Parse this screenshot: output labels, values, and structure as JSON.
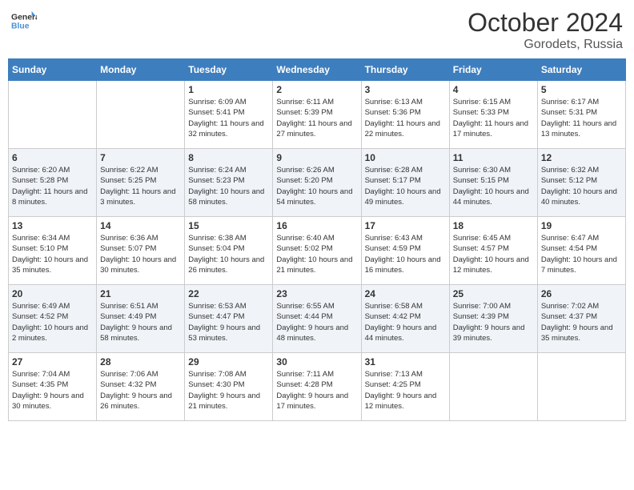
{
  "header": {
    "logo_line1": "General",
    "logo_line2": "Blue",
    "month": "October 2024",
    "location": "Gorodets, Russia"
  },
  "days_of_week": [
    "Sunday",
    "Monday",
    "Tuesday",
    "Wednesday",
    "Thursday",
    "Friday",
    "Saturday"
  ],
  "weeks": [
    [
      {
        "day": "",
        "sunrise": "",
        "sunset": "",
        "daylight": ""
      },
      {
        "day": "",
        "sunrise": "",
        "sunset": "",
        "daylight": ""
      },
      {
        "day": "1",
        "sunrise": "Sunrise: 6:09 AM",
        "sunset": "Sunset: 5:41 PM",
        "daylight": "Daylight: 11 hours and 32 minutes."
      },
      {
        "day": "2",
        "sunrise": "Sunrise: 6:11 AM",
        "sunset": "Sunset: 5:39 PM",
        "daylight": "Daylight: 11 hours and 27 minutes."
      },
      {
        "day": "3",
        "sunrise": "Sunrise: 6:13 AM",
        "sunset": "Sunset: 5:36 PM",
        "daylight": "Daylight: 11 hours and 22 minutes."
      },
      {
        "day": "4",
        "sunrise": "Sunrise: 6:15 AM",
        "sunset": "Sunset: 5:33 PM",
        "daylight": "Daylight: 11 hours and 17 minutes."
      },
      {
        "day": "5",
        "sunrise": "Sunrise: 6:17 AM",
        "sunset": "Sunset: 5:31 PM",
        "daylight": "Daylight: 11 hours and 13 minutes."
      }
    ],
    [
      {
        "day": "6",
        "sunrise": "Sunrise: 6:20 AM",
        "sunset": "Sunset: 5:28 PM",
        "daylight": "Daylight: 11 hours and 8 minutes."
      },
      {
        "day": "7",
        "sunrise": "Sunrise: 6:22 AM",
        "sunset": "Sunset: 5:25 PM",
        "daylight": "Daylight: 11 hours and 3 minutes."
      },
      {
        "day": "8",
        "sunrise": "Sunrise: 6:24 AM",
        "sunset": "Sunset: 5:23 PM",
        "daylight": "Daylight: 10 hours and 58 minutes."
      },
      {
        "day": "9",
        "sunrise": "Sunrise: 6:26 AM",
        "sunset": "Sunset: 5:20 PM",
        "daylight": "Daylight: 10 hours and 54 minutes."
      },
      {
        "day": "10",
        "sunrise": "Sunrise: 6:28 AM",
        "sunset": "Sunset: 5:17 PM",
        "daylight": "Daylight: 10 hours and 49 minutes."
      },
      {
        "day": "11",
        "sunrise": "Sunrise: 6:30 AM",
        "sunset": "Sunset: 5:15 PM",
        "daylight": "Daylight: 10 hours and 44 minutes."
      },
      {
        "day": "12",
        "sunrise": "Sunrise: 6:32 AM",
        "sunset": "Sunset: 5:12 PM",
        "daylight": "Daylight: 10 hours and 40 minutes."
      }
    ],
    [
      {
        "day": "13",
        "sunrise": "Sunrise: 6:34 AM",
        "sunset": "Sunset: 5:10 PM",
        "daylight": "Daylight: 10 hours and 35 minutes."
      },
      {
        "day": "14",
        "sunrise": "Sunrise: 6:36 AM",
        "sunset": "Sunset: 5:07 PM",
        "daylight": "Daylight: 10 hours and 30 minutes."
      },
      {
        "day": "15",
        "sunrise": "Sunrise: 6:38 AM",
        "sunset": "Sunset: 5:04 PM",
        "daylight": "Daylight: 10 hours and 26 minutes."
      },
      {
        "day": "16",
        "sunrise": "Sunrise: 6:40 AM",
        "sunset": "Sunset: 5:02 PM",
        "daylight": "Daylight: 10 hours and 21 minutes."
      },
      {
        "day": "17",
        "sunrise": "Sunrise: 6:43 AM",
        "sunset": "Sunset: 4:59 PM",
        "daylight": "Daylight: 10 hours and 16 minutes."
      },
      {
        "day": "18",
        "sunrise": "Sunrise: 6:45 AM",
        "sunset": "Sunset: 4:57 PM",
        "daylight": "Daylight: 10 hours and 12 minutes."
      },
      {
        "day": "19",
        "sunrise": "Sunrise: 6:47 AM",
        "sunset": "Sunset: 4:54 PM",
        "daylight": "Daylight: 10 hours and 7 minutes."
      }
    ],
    [
      {
        "day": "20",
        "sunrise": "Sunrise: 6:49 AM",
        "sunset": "Sunset: 4:52 PM",
        "daylight": "Daylight: 10 hours and 2 minutes."
      },
      {
        "day": "21",
        "sunrise": "Sunrise: 6:51 AM",
        "sunset": "Sunset: 4:49 PM",
        "daylight": "Daylight: 9 hours and 58 minutes."
      },
      {
        "day": "22",
        "sunrise": "Sunrise: 6:53 AM",
        "sunset": "Sunset: 4:47 PM",
        "daylight": "Daylight: 9 hours and 53 minutes."
      },
      {
        "day": "23",
        "sunrise": "Sunrise: 6:55 AM",
        "sunset": "Sunset: 4:44 PM",
        "daylight": "Daylight: 9 hours and 48 minutes."
      },
      {
        "day": "24",
        "sunrise": "Sunrise: 6:58 AM",
        "sunset": "Sunset: 4:42 PM",
        "daylight": "Daylight: 9 hours and 44 minutes."
      },
      {
        "day": "25",
        "sunrise": "Sunrise: 7:00 AM",
        "sunset": "Sunset: 4:39 PM",
        "daylight": "Daylight: 9 hours and 39 minutes."
      },
      {
        "day": "26",
        "sunrise": "Sunrise: 7:02 AM",
        "sunset": "Sunset: 4:37 PM",
        "daylight": "Daylight: 9 hours and 35 minutes."
      }
    ],
    [
      {
        "day": "27",
        "sunrise": "Sunrise: 7:04 AM",
        "sunset": "Sunset: 4:35 PM",
        "daylight": "Daylight: 9 hours and 30 minutes."
      },
      {
        "day": "28",
        "sunrise": "Sunrise: 7:06 AM",
        "sunset": "Sunset: 4:32 PM",
        "daylight": "Daylight: 9 hours and 26 minutes."
      },
      {
        "day": "29",
        "sunrise": "Sunrise: 7:08 AM",
        "sunset": "Sunset: 4:30 PM",
        "daylight": "Daylight: 9 hours and 21 minutes."
      },
      {
        "day": "30",
        "sunrise": "Sunrise: 7:11 AM",
        "sunset": "Sunset: 4:28 PM",
        "daylight": "Daylight: 9 hours and 17 minutes."
      },
      {
        "day": "31",
        "sunrise": "Sunrise: 7:13 AM",
        "sunset": "Sunset: 4:25 PM",
        "daylight": "Daylight: 9 hours and 12 minutes."
      },
      {
        "day": "",
        "sunrise": "",
        "sunset": "",
        "daylight": ""
      },
      {
        "day": "",
        "sunrise": "",
        "sunset": "",
        "daylight": ""
      }
    ]
  ]
}
